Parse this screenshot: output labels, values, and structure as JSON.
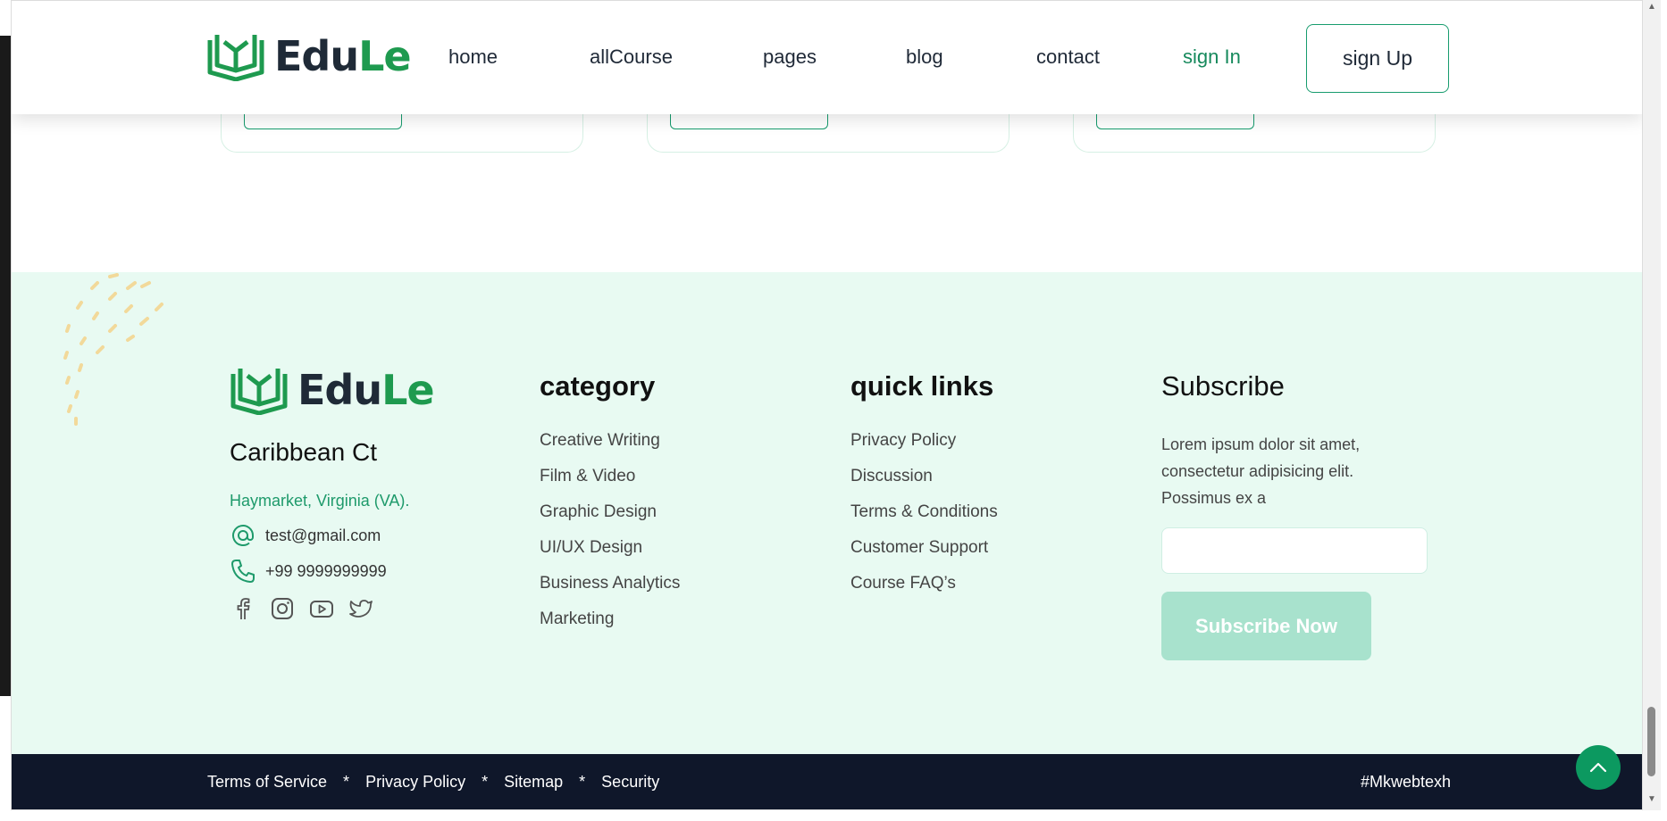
{
  "header": {
    "logo": {
      "part1": "Edu",
      "part2": "Le"
    },
    "nav": [
      "home",
      "allCourse",
      "pages",
      "blog",
      "contact"
    ],
    "signin": "sign In",
    "signup": "sign Up"
  },
  "footer": {
    "logo": {
      "part1": "Edu",
      "part2": "Le"
    },
    "address_title": "Caribbean Ct",
    "address_sub": "Haymarket, Virginia (VA).",
    "email": "test@gmail.com",
    "phone": "+99 9999999999",
    "socials": [
      "facebook-icon",
      "instagram-icon",
      "youtube-icon",
      "twitter-icon"
    ],
    "category": {
      "title": "category",
      "items": [
        "Creative Writing",
        "Film & Video",
        "Graphic Design",
        "UI/UX Design",
        "Business Analytics",
        "Marketing"
      ]
    },
    "quick_links": {
      "title": "quick links",
      "items": [
        "Privacy Policy",
        "Discussion",
        "Terms & Conditions",
        "Customer Support",
        "Course FAQ’s"
      ]
    },
    "subscribe": {
      "title": "Subscribe",
      "text": "Lorem ipsum dolor sit amet, consectetur adipisicing elit. Possimus ex a",
      "input_placeholder": "",
      "button": "Subscribe Now"
    }
  },
  "bottom_bar": {
    "links": [
      "Terms of Service",
      "Privacy Policy",
      "Sitemap",
      "Security"
    ],
    "separator": "*",
    "tag": "#Mkwebtexh"
  },
  "colors": {
    "brand_green": "#1e9a4f",
    "accent": "#179c6e",
    "footer_bg": "#e8faf2",
    "bottom_bg": "#0f172a"
  }
}
